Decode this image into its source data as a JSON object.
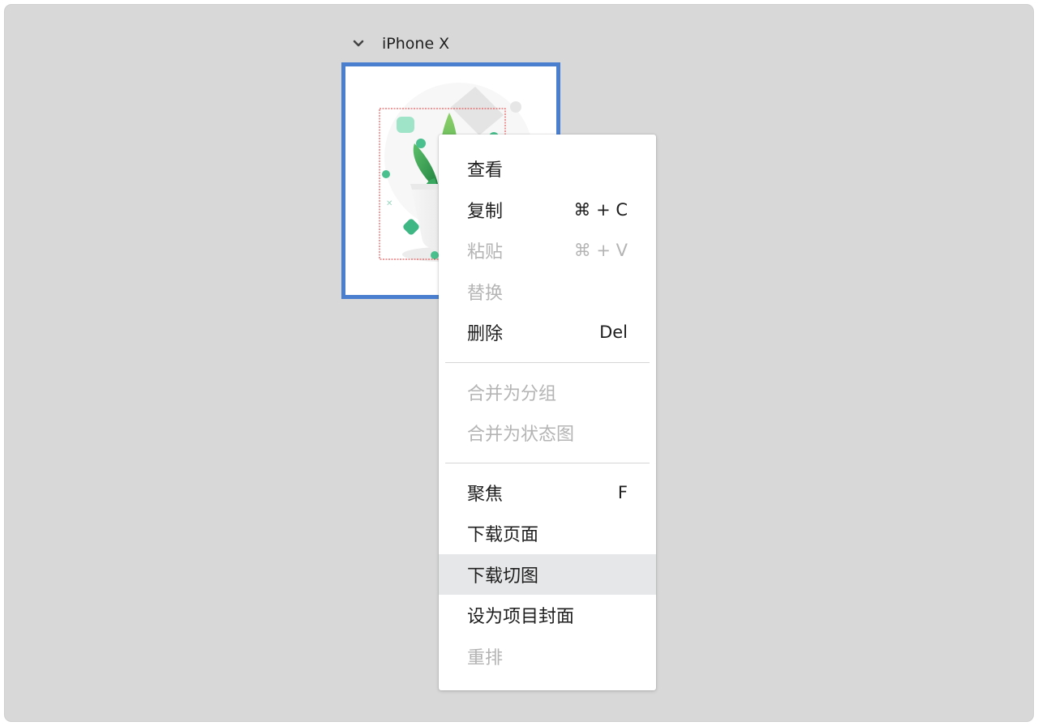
{
  "artboard": {
    "name": "iPhone X",
    "toggle_icon": "chevron-down-icon",
    "selection_color": "#4a7fd0"
  },
  "context_menu": {
    "groups": [
      [
        {
          "label": "查看",
          "shortcut": "",
          "enabled": true
        },
        {
          "label": "复制",
          "shortcut": "⌘ + C",
          "enabled": true
        },
        {
          "label": "粘贴",
          "shortcut": "⌘ + V",
          "enabled": false
        },
        {
          "label": "替换",
          "shortcut": "",
          "enabled": false
        },
        {
          "label": "删除",
          "shortcut": "Del",
          "enabled": true
        }
      ],
      [
        {
          "label": "合并为分组",
          "shortcut": "",
          "enabled": false
        },
        {
          "label": "合并为状态图",
          "shortcut": "",
          "enabled": false
        }
      ],
      [
        {
          "label": "聚焦",
          "shortcut": "F",
          "enabled": true
        },
        {
          "label": "下载页面",
          "shortcut": "",
          "enabled": true
        },
        {
          "label": "下载切图",
          "shortcut": "",
          "enabled": true,
          "hovered": true
        },
        {
          "label": "设为项目封面",
          "shortcut": "",
          "enabled": true
        },
        {
          "label": "重排",
          "shortcut": "",
          "enabled": false
        }
      ]
    ]
  },
  "colors": {
    "canvas_bg": "#d8d8d8",
    "menu_bg": "#ffffff",
    "hover_bg": "#e6e7e8",
    "disabled_text": "#b4b4b4"
  }
}
